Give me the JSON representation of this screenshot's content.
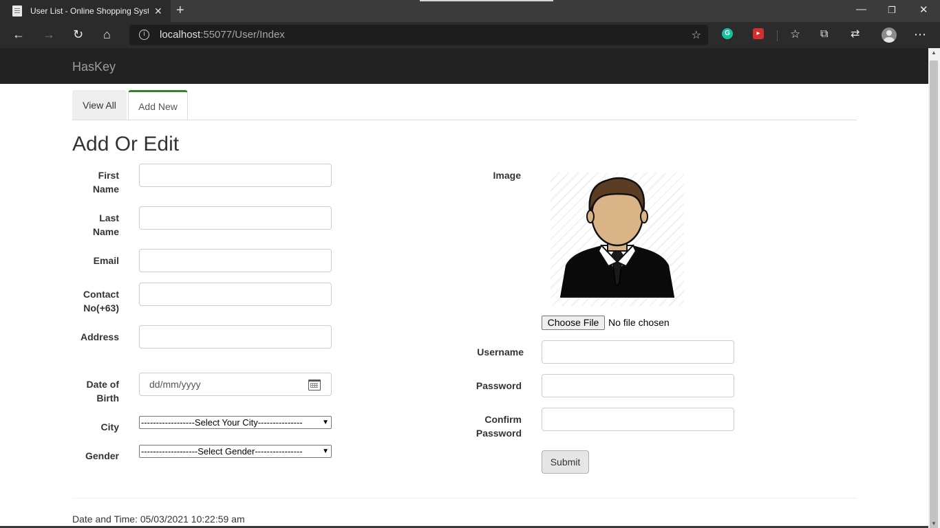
{
  "browser": {
    "tab_title": "User List - Online Shopping Syste",
    "url_host": "localhost",
    "url_rest": ":55077/User/Index"
  },
  "site": {
    "brand": "HasKey"
  },
  "tabs": [
    {
      "label": "View All",
      "active": false
    },
    {
      "label": "Add New",
      "active": true
    }
  ],
  "form": {
    "title": "Add Or Edit",
    "first_name": {
      "label_line1": "First",
      "label_line2": "Name",
      "value": ""
    },
    "last_name": {
      "label_line1": "Last",
      "label_line2": "Name",
      "value": ""
    },
    "email": {
      "label": "Email",
      "value": ""
    },
    "contact": {
      "label_line1": "Contact",
      "label_line2": "No(+63)",
      "value": ""
    },
    "address": {
      "label": "Address",
      "value": ""
    },
    "dob": {
      "label_line1": "Date of",
      "label_line2": "Birth",
      "placeholder": "dd/mm/yyyy"
    },
    "city": {
      "label": "City",
      "selected": "------------------Select Your City---------------"
    },
    "gender": {
      "label": "Gender",
      "selected": "-------------------Select Gender----------------"
    },
    "image": {
      "label": "Image",
      "choose_label": "Choose File",
      "status": "No file chosen"
    },
    "username": {
      "label": "Username",
      "value": ""
    },
    "password": {
      "label": "Password",
      "value": ""
    },
    "confirm": {
      "label_line1": "Confirm",
      "label_line2": "Password",
      "value": ""
    },
    "submit_label": "Submit"
  },
  "footer": {
    "text": "Date and Time: 05/03/2021 10:22:59 am"
  },
  "colors": {
    "navbar": "#222222",
    "active_tab_accent": "#228b22"
  }
}
